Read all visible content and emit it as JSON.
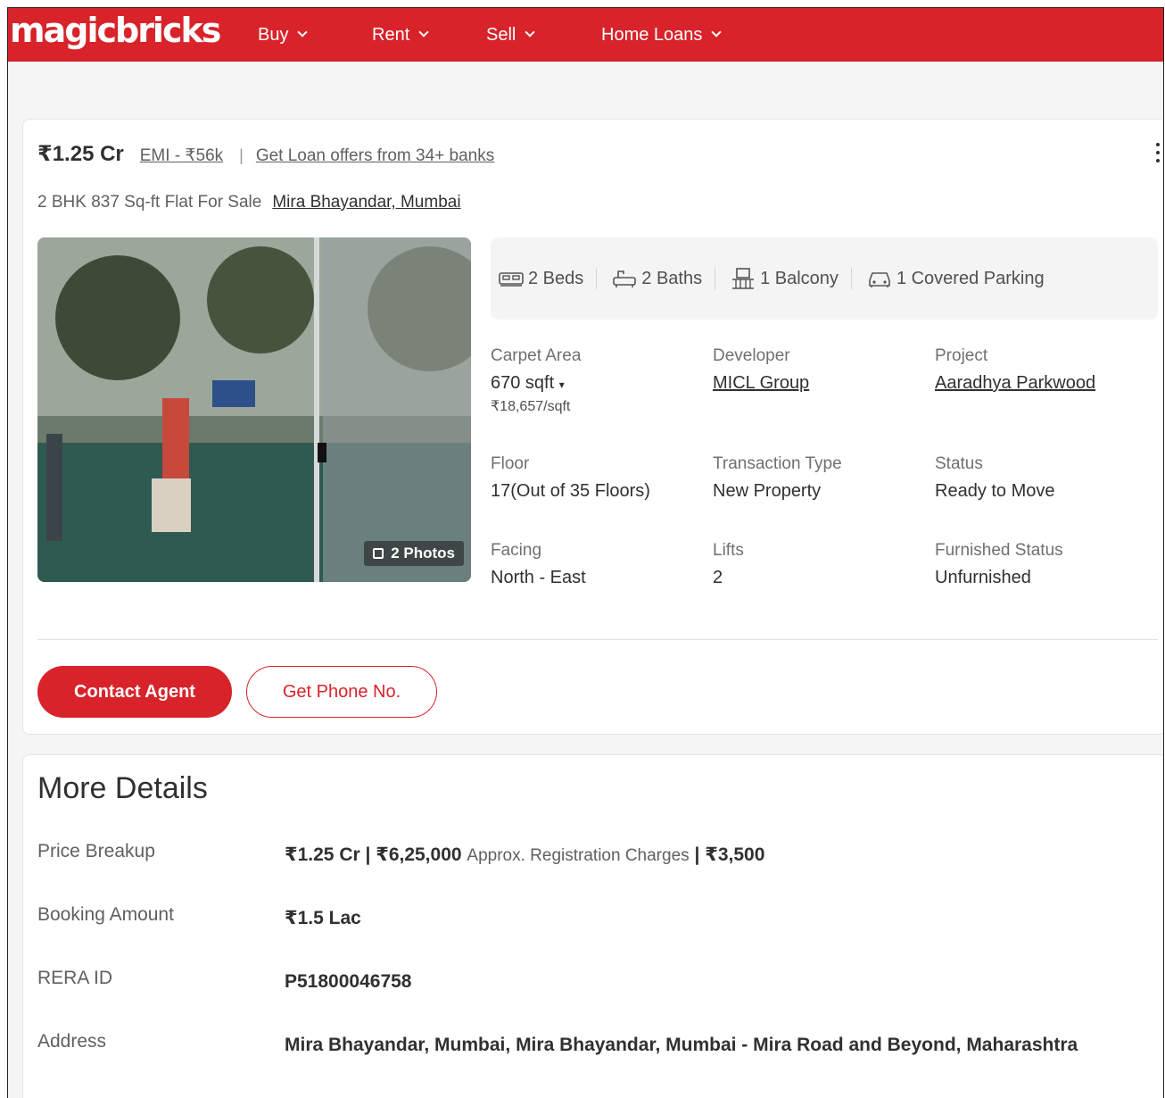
{
  "header": {
    "logo": "magicbricks",
    "nav": [
      "Buy",
      "Rent",
      "Sell",
      "Home Loans"
    ]
  },
  "listing": {
    "price": "₹1.25 Cr",
    "emi": "EMI - ₹56k",
    "loan_offer": "Get Loan offers from 34+ banks",
    "title": "2 BHK 837 Sq-ft Flat For Sale",
    "location": "Mira Bhayandar, Mumbai",
    "photos_label": "2 Photos",
    "amenities": {
      "beds": "2 Beds",
      "baths": "2 Baths",
      "balcony": "1 Balcony",
      "parking": "1 Covered Parking"
    },
    "specs": {
      "carpet_area": {
        "label": "Carpet Area",
        "value": "670 sqft",
        "sub": "₹18,657/sqft"
      },
      "developer": {
        "label": "Developer",
        "value": "MICL Group"
      },
      "project": {
        "label": "Project",
        "value": "Aaradhya Parkwood"
      },
      "floor": {
        "label": "Floor",
        "value": "17(Out of 35 Floors)"
      },
      "transaction": {
        "label": "Transaction Type",
        "value": "New Property"
      },
      "status": {
        "label": "Status",
        "value": "Ready to Move"
      },
      "facing": {
        "label": "Facing",
        "value": "North - East"
      },
      "lifts": {
        "label": "Lifts",
        "value": "2"
      },
      "furnished": {
        "label": "Furnished Status",
        "value": "Unfurnished"
      }
    },
    "contact_button": "Contact Agent",
    "phone_button": "Get Phone No."
  },
  "more_details": {
    "heading": "More Details",
    "price_breakup": {
      "label": "Price Breakup",
      "value": "₹1.25 Cr | ₹6,25,000",
      "note": "Approx. Registration Charges",
      "extra": "| ₹3,500"
    },
    "booking": {
      "label": "Booking Amount",
      "value": "₹1.5 Lac"
    },
    "rera": {
      "label": "RERA ID",
      "value": "P51800046758"
    },
    "address": {
      "label": "Address",
      "value": "Mira Bhayandar, Mumbai, Mira Bhayandar, Mumbai - Mira Road and Beyond, Maharashtra"
    }
  },
  "colors": {
    "brand": "#d8232a",
    "text": "#303030",
    "muted": "#606060"
  }
}
